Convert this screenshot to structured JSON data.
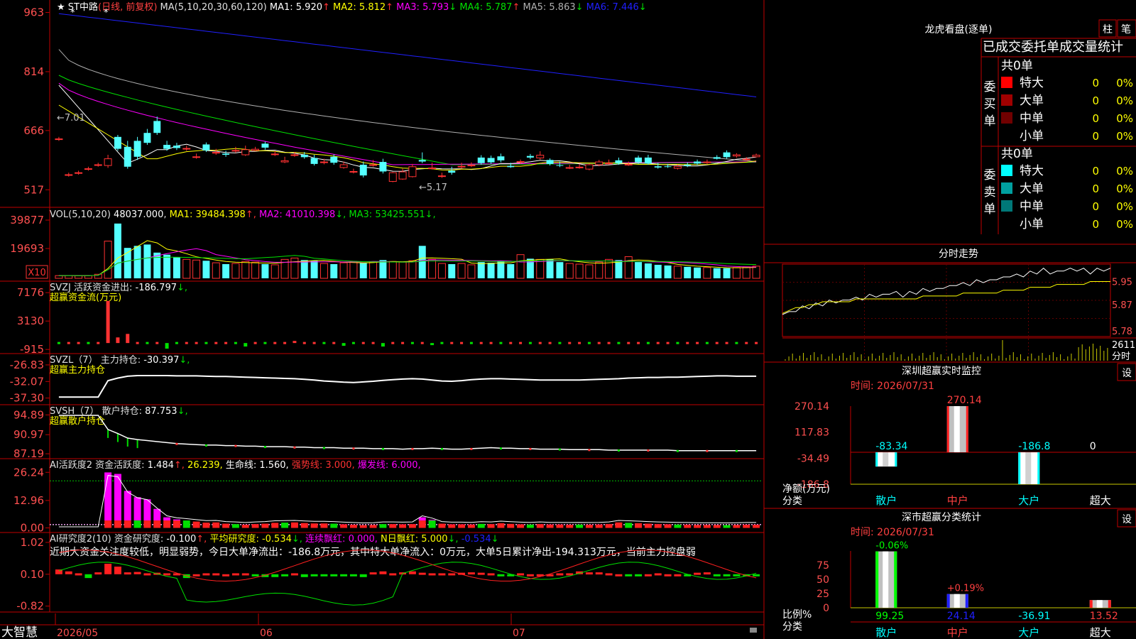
{
  "colors": {
    "up": "#ff3232",
    "down": "#54ffff",
    "ma1": "#ffffff",
    "ma2": "#ffff00",
    "ma3": "#ff00ff",
    "ma4": "#00e000",
    "ma5": "#b0b0b0",
    "ma6": "#2020ff",
    "grid": "#c00000",
    "axisText": "#ff5050"
  },
  "chart_data": [
    {
      "type": "candlestick",
      "panel": "main",
      "title": "ST中路",
      "period": "(日线, 前复权)",
      "ma_label": "MA(5,10,20,30,60,120)",
      "ma_values": [
        {
          "name": "MA1",
          "value": "5.920",
          "trend": "↑"
        },
        {
          "name": "MA2",
          "value": "5.812",
          "trend": "↑"
        },
        {
          "name": "MA3",
          "value": "5.793",
          "trend": "↓"
        },
        {
          "name": "MA4",
          "value": "5.787",
          "trend": "↑"
        },
        {
          "name": "MA5",
          "value": "5.863",
          "trend": "↓"
        },
        {
          "name": "MA6",
          "value": "7.446",
          "trend": "↓"
        }
      ],
      "y_ticks": [
        "963",
        "814",
        "666",
        "517"
      ],
      "ylim": [
        4.8,
        9.8
      ],
      "high_marker": "7.01",
      "low_marker": "5.17",
      "opens": [
        6.45,
        5.55,
        5.6,
        5.7,
        5.8,
        5.78,
        6.5,
        6.25,
        6.4,
        6.6,
        6.9,
        6.3,
        6.28,
        6.21,
        6.0,
        6.31,
        6.1,
        6.08,
        6.16,
        6.05,
        6.16,
        6.33,
        6.07,
        5.87,
        6.05,
        6.05,
        5.97,
        5.86,
        6.0,
        5.73,
        5.63,
        5.8,
        5.8,
        5.87,
        5.38,
        5.44,
        5.5,
        5.92,
        5.7,
        5.52,
        5.65,
        5.75,
        5.79,
        5.98,
        5.97,
        6.01,
        5.77,
        5.86,
        6.02,
        5.97,
        5.92,
        5.79,
        5.71,
        5.74,
        5.69,
        5.8,
        5.83,
        5.91,
        5.81,
        5.98,
        5.98,
        5.76,
        5.76,
        5.71,
        5.8,
        5.88,
        5.85,
        5.99,
        6.11,
        6.02,
        5.93,
        6.0
      ],
      "closes": [
        6.45,
        5.55,
        5.6,
        5.7,
        5.8,
        5.95,
        6.2,
        5.75,
        6.0,
        6.35,
        6.6,
        6.2,
        6.22,
        6.21,
        6.0,
        6.16,
        6.11,
        6.05,
        6.16,
        6.18,
        6.19,
        6.23,
        6.07,
        5.9,
        6.05,
        5.99,
        5.82,
        5.87,
        5.85,
        5.8,
        5.63,
        5.53,
        5.8,
        5.63,
        5.6,
        5.62,
        5.75,
        5.88,
        5.72,
        5.52,
        5.6,
        5.76,
        5.79,
        5.84,
        5.86,
        5.91,
        5.74,
        5.88,
        5.98,
        6.04,
        5.82,
        5.78,
        5.73,
        5.74,
        5.8,
        5.87,
        5.84,
        5.84,
        5.81,
        5.86,
        5.83,
        5.73,
        5.75,
        5.76,
        5.77,
        5.83,
        5.87,
        5.95,
        5.99,
        6.05,
        5.94,
        6.04
      ],
      "highs": [
        6.5,
        5.6,
        5.65,
        5.75,
        5.85,
        6.05,
        6.55,
        6.4,
        6.5,
        6.7,
        7.01,
        6.4,
        6.35,
        6.28,
        6.08,
        6.36,
        6.2,
        6.15,
        6.25,
        6.28,
        6.25,
        6.38,
        6.15,
        6.0,
        6.12,
        6.12,
        6.05,
        5.95,
        6.06,
        5.88,
        5.7,
        5.88,
        5.92,
        5.95,
        5.62,
        5.7,
        5.82,
        6.11,
        5.85,
        5.6,
        5.75,
        5.85,
        5.86,
        6.04,
        6.03,
        6.08,
        5.85,
        5.93,
        6.07,
        6.14,
        5.96,
        5.88,
        5.8,
        5.81,
        5.83,
        5.92,
        5.93,
        5.98,
        5.88,
        6.03,
        6.05,
        5.85,
        5.82,
        5.8,
        5.86,
        5.93,
        5.93,
        6.04,
        6.16,
        6.09,
        5.99,
        6.08
      ],
      "lows": [
        6.4,
        5.5,
        5.55,
        5.65,
        5.75,
        5.72,
        6.15,
        5.7,
        5.92,
        6.3,
        6.55,
        6.15,
        6.17,
        6.15,
        5.95,
        6.12,
        6.05,
        6.0,
        6.1,
        6.02,
        6.14,
        6.18,
        6.02,
        5.84,
        6.0,
        5.95,
        5.78,
        5.81,
        5.8,
        5.7,
        5.58,
        5.48,
        5.75,
        5.58,
        5.36,
        5.42,
        5.48,
        5.84,
        5.68,
        5.47,
        5.55,
        5.7,
        5.74,
        5.8,
        5.82,
        5.86,
        5.72,
        5.82,
        5.94,
        5.93,
        5.78,
        5.74,
        5.69,
        5.7,
        5.66,
        5.76,
        5.8,
        5.8,
        5.77,
        5.82,
        5.8,
        5.7,
        5.72,
        5.68,
        5.74,
        5.79,
        5.82,
        5.93,
        5.95,
        5.98,
        5.9,
        5.98
      ]
    },
    {
      "type": "bar",
      "panel": "volume",
      "label": "VOL(5,10,20)",
      "current": "48037.000",
      "ma_values": [
        {
          "name": "MA1",
          "value": "39484.398",
          "trend": "↑"
        },
        {
          "name": "MA2",
          "value": "41010.398",
          "trend": "↓"
        },
        {
          "name": "MA3",
          "value": "53425.551",
          "trend": "↓"
        }
      ],
      "y_ticks": [
        "39877",
        "19693",
        "X10"
      ],
      "ylim": [
        0,
        8400
      ],
      "values": [
        400,
        420,
        380,
        410,
        600,
        5500,
        8100,
        4500,
        4800,
        5000,
        3800,
        3500,
        3100,
        2800,
        2700,
        2600,
        2300,
        2100,
        2200,
        2500,
        2400,
        2100,
        2000,
        2800,
        3000,
        2700,
        2600,
        2200,
        2100,
        2300,
        2500,
        2300,
        2400,
        2700,
        2500,
        2400,
        2600,
        4800,
        2800,
        2200,
        2100,
        2200,
        2000,
        2400,
        2300,
        2600,
        2100,
        3500,
        2900,
        2800,
        2800,
        2400,
        2200,
        2100,
        2000,
        2400,
        2800,
        2700,
        3200,
        2400,
        2200,
        2000,
        1900,
        1800,
        1700,
        1600,
        1600,
        1500,
        1500,
        1600,
        1700,
        1800
      ]
    },
    {
      "type": "bar",
      "panel": "svzj",
      "label": "SVZJ",
      "line_label": "活跃资金进出:",
      "value": "-186.797",
      "trend": "↓",
      "subtitle": "超赢资金流(万元)",
      "y_ticks": [
        "7176",
        "3130",
        "-915"
      ],
      "ylim": [
        -1300,
        7800
      ],
      "values": [
        0,
        0,
        0,
        0,
        0,
        6000,
        800,
        1300,
        0,
        0,
        0,
        -800,
        0,
        0,
        0,
        0,
        0,
        0,
        0,
        -500,
        0,
        0,
        0,
        0,
        300,
        0,
        0,
        0,
        0,
        -400,
        0,
        0,
        0,
        -500,
        0,
        0,
        0,
        0,
        -300,
        0,
        0,
        0,
        0,
        0,
        0,
        0,
        0,
        0,
        0,
        0,
        0,
        0,
        0,
        0,
        0,
        0,
        0,
        0,
        0,
        0,
        0,
        0,
        0,
        0,
        0,
        0,
        0,
        0,
        0,
        0,
        0,
        0
      ]
    },
    {
      "type": "line",
      "panel": "svzl",
      "label": "SVZL（7）",
      "line_label": "主力持仓:",
      "value": "-30.397",
      "trend": "↓",
      "subtitle": "超赢主力持仓",
      "y_ticks": [
        "-26.83",
        "-32.07",
        "-37.30"
      ],
      "ylim": [
        -38.5,
        -25.5
      ],
      "values": [
        -37.0,
        -37.0,
        -37.0,
        -37.0,
        -37.0,
        -31.8,
        -31.0,
        -30.4,
        -30.2,
        -30.2,
        -30.2,
        -30.2,
        -30.3,
        -30.3,
        -30.3,
        -30.4,
        -30.5,
        -30.5,
        -30.6,
        -30.7,
        -30.8,
        -30.9,
        -31.0,
        -31.1,
        -31.2,
        -31.4,
        -31.6,
        -31.9,
        -32.1,
        -32.3,
        -32.4,
        -32.2,
        -32.0,
        -31.7,
        -31.5,
        -31.3,
        -31.2,
        -31.3,
        -31.6,
        -31.9,
        -32.0,
        -31.8,
        -31.5,
        -31.3,
        -31.2,
        -31.2,
        -31.3,
        -31.4,
        -31.5,
        -31.6,
        -31.6,
        -31.6,
        -31.6,
        -31.6,
        -31.5,
        -31.4,
        -31.3,
        -31.2,
        -31.0,
        -30.9,
        -30.8,
        -30.8,
        -30.7,
        -30.7,
        -30.6,
        -30.5,
        -30.4,
        -30.3,
        -30.3,
        -30.4,
        -30.4,
        -30.4
      ]
    },
    {
      "type": "line",
      "panel": "svsh",
      "label": "SVSH（7）",
      "line_label": "散户持仓:",
      "value": "87.753",
      "trend": "↓",
      "subtitle": "超赢散户持仓",
      "y_ticks": [
        "94.89",
        "90.97",
        "87.19"
      ],
      "ylim": [
        86.5,
        95.5
      ],
      "values": [
        94.8,
        94.8,
        94.8,
        94.8,
        94.8,
        92.0,
        91.2,
        90.3,
        90.0,
        89.8,
        89.6,
        89.4,
        89.2,
        89.1,
        89.0,
        88.9,
        88.9,
        88.8,
        88.8,
        88.7,
        88.7,
        88.6,
        88.6,
        88.6,
        88.5,
        88.5,
        88.4,
        88.4,
        88.4,
        88.3,
        88.3,
        88.3,
        88.2,
        88.2,
        88.2,
        88.1,
        88.2,
        88.2,
        88.3,
        88.2,
        88.1,
        88.1,
        88.2,
        88.3,
        88.4,
        88.3,
        88.3,
        88.2,
        88.2,
        88.1,
        88.1,
        88.1,
        88.0,
        88.0,
        88.0,
        88.0,
        87.9,
        87.9,
        87.9,
        87.9,
        87.9,
        87.9,
        87.9,
        87.8,
        87.8,
        87.8,
        87.8,
        87.8,
        87.8,
        87.8,
        87.8,
        87.8
      ]
    },
    {
      "type": "bar",
      "panel": "ai_active",
      "label": "AI活跃度2",
      "items": [
        {
          "name": "资金活跃度:",
          "value": "1.484",
          "trend": "↑"
        },
        {
          "name": "",
          "value": "26.239",
          "trend": ""
        },
        {
          "name": "生命线:",
          "value": "1.560",
          "trend": ""
        },
        {
          "name": "强势线:",
          "value": "3.000",
          "trend": ""
        },
        {
          "name": "爆发线:",
          "value": "6.000",
          "trend": ""
        }
      ],
      "y_ticks": [
        "26.24",
        "12.96",
        "0.00"
      ],
      "ylim": [
        -1.5,
        28
      ],
      "values": [
        0.1,
        0.1,
        0.1,
        0.1,
        0.1,
        26.2,
        25.5,
        17.5,
        14.5,
        13.5,
        9.0,
        5.0,
        4.0,
        3.5,
        3.0,
        2.5,
        2.6,
        2.0,
        1.8,
        1.5,
        1.8,
        2.0,
        2.4,
        2.5,
        2.6,
        2.3,
        2.1,
        2.1,
        2.0,
        1.7,
        1.5,
        1.3,
        1.4,
        1.8,
        1.8,
        1.7,
        1.8,
        5.0,
        3.8,
        2.0,
        1.7,
        1.7,
        1.6,
        1.9,
        1.8,
        2.2,
        1.9,
        1.7,
        1.6,
        1.8,
        1.6,
        1.6,
        1.5,
        1.6,
        1.5,
        1.6,
        1.8,
        2.6,
        2.4,
        2.2,
        2.0,
        1.8,
        1.7,
        1.6,
        1.5,
        1.4,
        1.4,
        1.4,
        1.3,
        1.4,
        1.5,
        1.5
      ]
    },
    {
      "type": "bar",
      "panel": "ai_research",
      "label": "AI研究度2(10)",
      "items": [
        {
          "name": "资金研究度:",
          "value": "-0.100",
          "trend": "↑"
        },
        {
          "name": "平均研究度:",
          "value": "-0.534",
          "trend": "↓"
        },
        {
          "name": "连续飘红:",
          "value": "0.000",
          "trend": ""
        },
        {
          "name": "N日飘红:",
          "value": "5.000",
          "trend": "↓"
        },
        {
          "name": "",
          "value": "-0.534",
          "trend": "↓"
        }
      ],
      "commentary": "近期大资金关注度较低，明显弱势，今日大单净流出：-186.8万元，其中特大单净流入：0万元，大单5日累计净出-194.313万元，当前主力控盘弱",
      "y_ticks": [
        "1.02",
        "0.10",
        "-0.82"
      ],
      "ylim": [
        -0.95,
        1.1
      ],
      "values": [
        0.25,
        0.15,
        0.05,
        -0.2,
        0.1,
        0.55,
        0.4,
        0.1,
        0.12,
        0.05,
        0.08,
        0.05,
        0.05,
        -0.2,
        0.0,
        0.05,
        0.05,
        0.0,
        0.05,
        0.05,
        -0.05,
        -0.15,
        -0.15,
        -0.05,
        0.05,
        -0.15,
        -0.1,
        -0.05,
        -0.1,
        -0.1,
        -0.1,
        -0.15,
        0.1,
        0.15,
        0.05,
        0.1,
        0.15,
        0.08,
        0.05,
        0.05,
        0.05,
        0.08,
        0.1,
        0.08,
        0.05,
        -0.05,
        -0.1,
        0.05,
        0.0,
        0.0,
        0.0,
        0.05,
        0.05,
        0.15,
        0.1,
        0.1,
        0.05,
        0.0,
        -0.05,
        -0.05,
        0.0,
        0.05,
        0.0,
        0.0,
        -0.02,
        0.08,
        0.1,
        -0.05,
        -0.05,
        -0.1,
        -0.1,
        -0.1
      ]
    }
  ],
  "x_axis": {
    "labels": [
      "2026/05",
      "06",
      "07"
    ]
  },
  "brand": "大智慧",
  "right_panel": {
    "dragon_tiger": {
      "title": "龙虎看盘(逐单)",
      "btn1": "柱",
      "btn2": "笔",
      "header": "已成交委托单成交量统计",
      "buy_side": "委买单",
      "sell_side": "委卖单",
      "buy_total": "共0单",
      "sell_total": "共0单",
      "buy_rows": [
        {
          "label": "特大",
          "count": "0",
          "pct": "0%",
          "color": "#ff0000"
        },
        {
          "label": "大单",
          "count": "0",
          "pct": "0%",
          "color": "#a00000"
        },
        {
          "label": "中单",
          "count": "0",
          "pct": "0%",
          "color": "#700000"
        },
        {
          "label": "小单",
          "count": "0",
          "pct": "0%",
          "color": "#000000"
        }
      ],
      "sell_rows": [
        {
          "label": "特大",
          "count": "0",
          "pct": "0%",
          "color": "#00ffff"
        },
        {
          "label": "大单",
          "count": "0",
          "pct": "0%",
          "color": "#00a0a0"
        },
        {
          "label": "中单",
          "count": "0",
          "pct": "0%",
          "color": "#007878"
        },
        {
          "label": "小单",
          "count": "0",
          "pct": "0%",
          "color": "#000000"
        }
      ]
    },
    "intraday": {
      "title": "分时走势",
      "y_ticks": [
        "5.95",
        "5.87",
        "5.78"
      ],
      "vol_label": "2611",
      "vol_unit": "分时",
      "price": [
        5.84,
        5.84,
        5.85,
        5.86,
        5.86,
        5.87,
        5.87,
        5.88,
        5.88,
        5.88,
        5.89,
        5.89,
        5.89,
        5.9,
        5.9,
        5.9,
        5.91,
        5.91,
        5.9,
        5.91,
        5.91,
        5.92,
        5.92,
        5.92,
        5.93,
        5.93,
        5.94,
        5.94,
        5.94,
        5.95,
        5.95,
        5.95,
        5.96,
        5.96,
        5.97,
        5.97,
        5.97,
        5.98,
        5.98,
        5.99,
        5.98,
        5.98,
        5.99,
        5.99,
        5.99,
        5.99,
        5.98,
        5.99,
        5.99,
        5.99
      ],
      "avg": [
        5.84,
        5.85,
        5.86,
        5.86,
        5.87,
        5.87,
        5.88,
        5.88,
        5.88,
        5.88,
        5.88,
        5.89,
        5.89,
        5.89,
        5.89,
        5.89,
        5.89,
        5.89,
        5.89,
        5.89,
        5.89,
        5.9,
        5.9,
        5.9,
        5.9,
        5.9,
        5.9,
        5.91,
        5.91,
        5.91,
        5.91,
        5.91,
        5.91,
        5.92,
        5.92,
        5.92,
        5.92,
        5.93,
        5.93,
        5.93,
        5.93,
        5.94,
        5.94,
        5.94,
        5.94,
        5.94,
        5.95,
        5.95,
        5.95,
        5.95
      ],
      "ylim": [
        5.76,
        6.01
      ]
    },
    "sz_monitor": {
      "title": "深圳超赢实时监控",
      "btn": "设",
      "time_label": "时间: 2026/07/31",
      "y_ticks": [
        "270.14",
        "117.83",
        "-34.49",
        "-186.8"
      ],
      "ylim": [
        -186.8,
        270.14
      ],
      "categories": [
        "散户",
        "中户",
        "大户",
        "超大"
      ],
      "values": [
        -83.34,
        270.14,
        -186.8,
        0
      ],
      "value_labels": [
        "-83.34",
        "270.14",
        "-186.8",
        "0"
      ],
      "side_label1": "净额(万元)",
      "side_label2": "分类"
    },
    "sz_stats": {
      "title": "深市超赢分类统计",
      "btn": "设",
      "time_label": "时间: 2026/07/31",
      "y_ticks": [
        "75",
        "50",
        "25",
        "0"
      ],
      "ylim": [
        0,
        100
      ],
      "categories": [
        "散户",
        "中户",
        "大户",
        "超大"
      ],
      "bar_values": [
        99.25,
        24.14,
        0,
        13.52
      ],
      "pct_labels": [
        "-0.06%",
        "+0.19%",
        "",
        ""
      ],
      "value_labels": [
        "99.25",
        "24.14",
        "-36.91",
        "13.52"
      ],
      "side_label1": "比例%",
      "side_label2": "分类"
    }
  }
}
